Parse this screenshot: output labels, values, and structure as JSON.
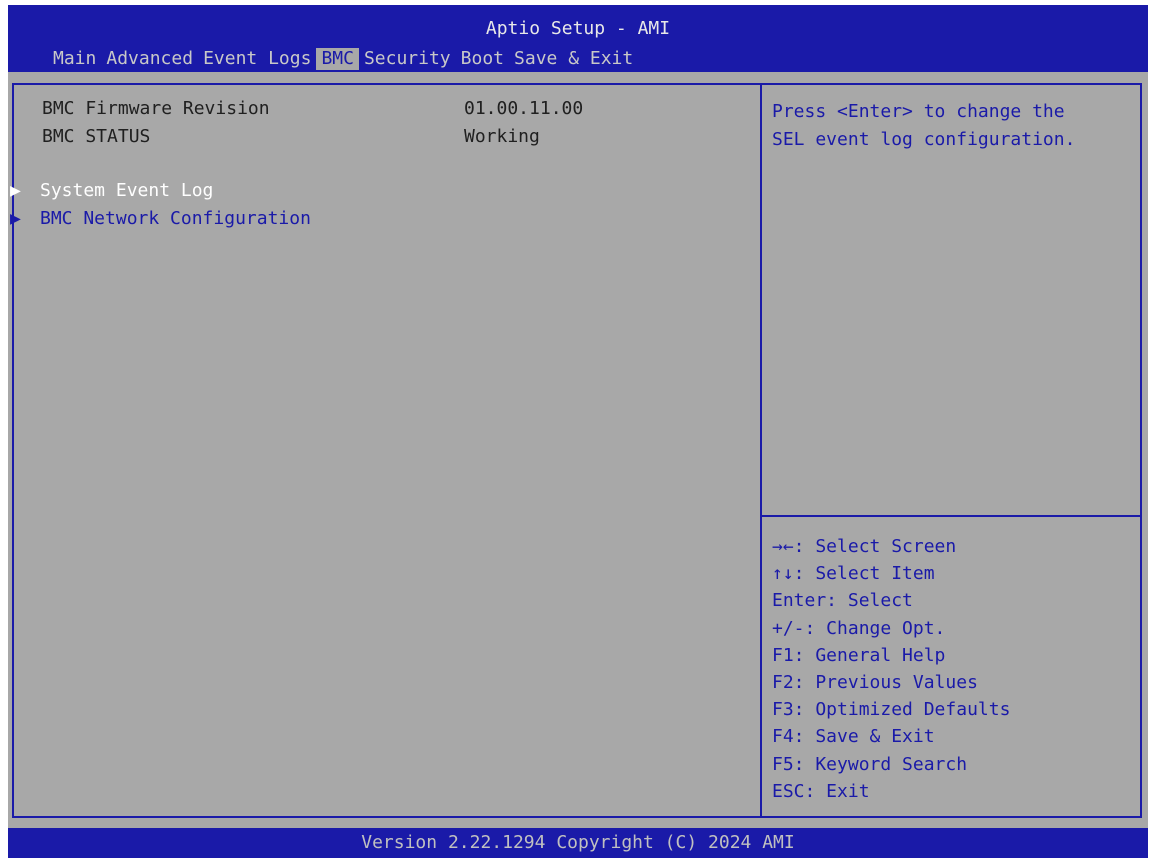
{
  "header": {
    "title": "Aptio Setup - AMI",
    "tabs": [
      {
        "label": "Main"
      },
      {
        "label": "Advanced"
      },
      {
        "label": "Event Logs"
      },
      {
        "label": "BMC"
      },
      {
        "label": "Security"
      },
      {
        "label": "Boot"
      },
      {
        "label": "Save & Exit"
      }
    ],
    "active_tab": "BMC"
  },
  "main": {
    "info": [
      {
        "label": "BMC Firmware Revision",
        "value": "01.00.11.00"
      },
      {
        "label": "BMC STATUS",
        "value": "Working"
      }
    ],
    "submenus": [
      {
        "label": "System Event Log",
        "selected": true
      },
      {
        "label": "BMC Network Configuration",
        "selected": false
      }
    ]
  },
  "help": {
    "lines": [
      "Press <Enter> to change the",
      "SEL event log configuration."
    ]
  },
  "keys": [
    "→←: Select Screen",
    "↑↓: Select Item",
    "Enter: Select",
    "+/-: Change Opt.",
    "F1: General Help",
    "F2: Previous Values",
    "F3: Optimized Defaults",
    "F4: Save & Exit",
    "F5: Keyword Search",
    "ESC: Exit"
  ],
  "footer": {
    "text": "Version 2.22.1294 Copyright (C) 2024 AMI"
  },
  "icons": {
    "submenu_arrow": "▶"
  },
  "colors": {
    "bios_blue": "#1a1aa8",
    "bios_gray": "#a8a8a8",
    "highlight": "#ffffff"
  }
}
